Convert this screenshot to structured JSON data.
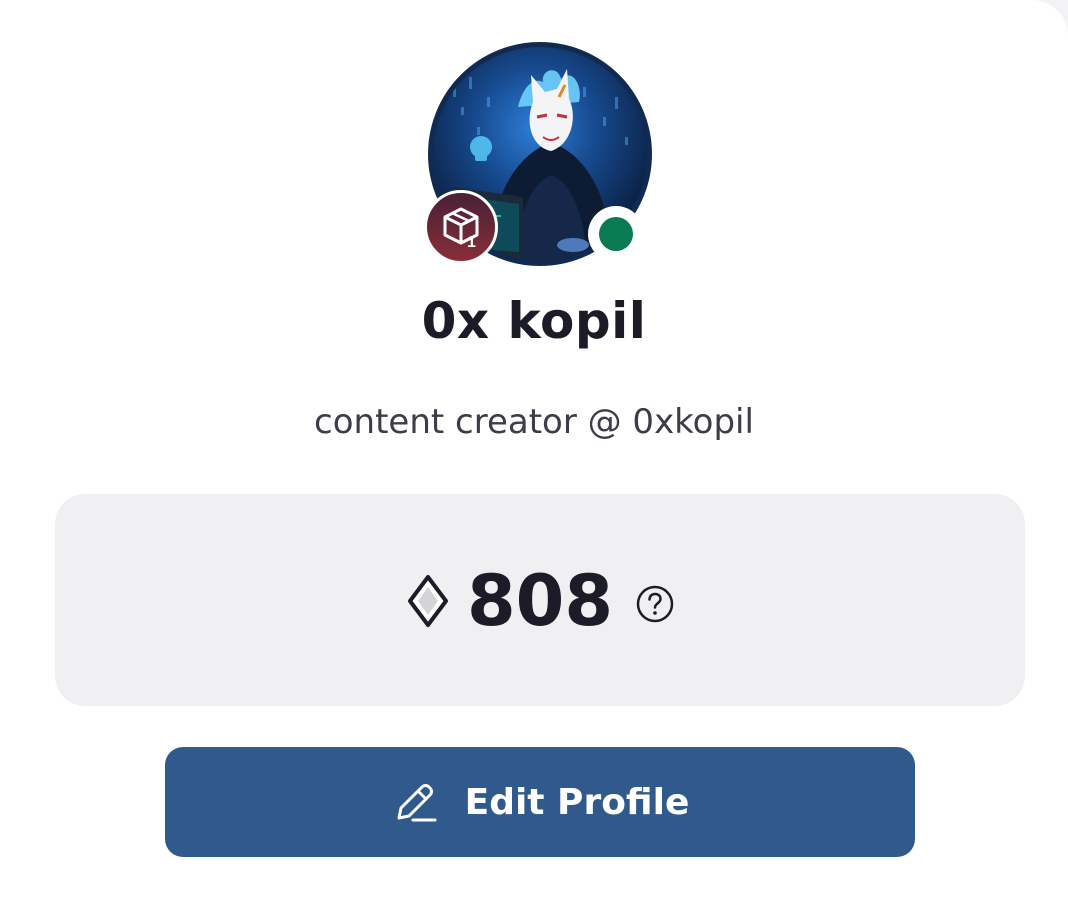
{
  "profile": {
    "name": "0x kopil",
    "bio": "content creator @ 0xkopil",
    "level": "1",
    "online": true,
    "status_color": "#0a7a52"
  },
  "points": {
    "value": "808",
    "icon": "diamond-icon",
    "help_icon": "question-circle-icon"
  },
  "actions": {
    "edit_label": "Edit Profile",
    "edit_icon": "pencil-icon",
    "button_color": "#305a8c"
  }
}
